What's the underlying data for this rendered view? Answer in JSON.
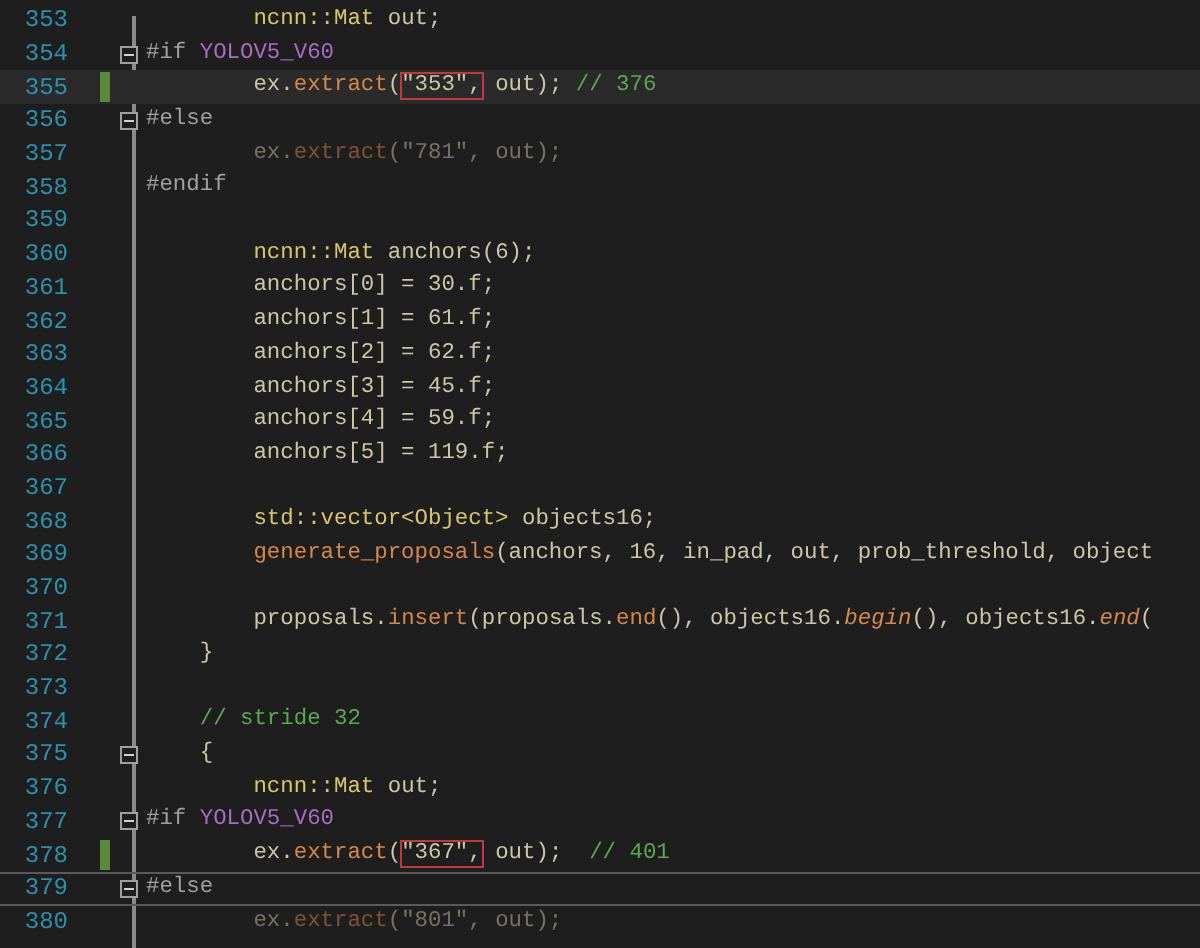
{
  "editor": {
    "lines": [
      {
        "number": "353",
        "current": false,
        "changed": false,
        "collapsible": false,
        "inactive": false,
        "framed": false,
        "tokens": [
          {
            "kind": "type",
            "text": "        ncnn::Mat"
          },
          {
            "kind": "plain",
            "text": " out;"
          }
        ]
      },
      {
        "number": "354",
        "current": false,
        "changed": false,
        "collapsible": true,
        "inactive": false,
        "framed": false,
        "tokens": [
          {
            "kind": "preproc",
            "text": "#if "
          },
          {
            "kind": "macro",
            "text": "YOLOV5_V60"
          }
        ]
      },
      {
        "number": "355",
        "current": true,
        "changed": true,
        "collapsible": false,
        "inactive": false,
        "framed": false,
        "tokens": [
          {
            "kind": "plain",
            "text": "        ex."
          },
          {
            "kind": "func",
            "text": "extract"
          },
          {
            "kind": "plain",
            "text": "("
          },
          {
            "kind": "boxed",
            "text": "\"353\","
          },
          {
            "kind": "plain",
            "text": " out); "
          },
          {
            "kind": "comment",
            "text": "// 376"
          }
        ]
      },
      {
        "number": "356",
        "current": false,
        "changed": false,
        "collapsible": true,
        "inactive": false,
        "framed": false,
        "tokens": [
          {
            "kind": "preproc",
            "text": "#else"
          }
        ]
      },
      {
        "number": "357",
        "current": false,
        "changed": false,
        "collapsible": false,
        "inactive": true,
        "framed": false,
        "tokens": [
          {
            "kind": "plain",
            "text": "        ex."
          },
          {
            "kind": "func",
            "text": "extract"
          },
          {
            "kind": "plain",
            "text": "(\"781\", out);"
          }
        ]
      },
      {
        "number": "358",
        "current": false,
        "changed": false,
        "collapsible": false,
        "inactive": false,
        "framed": false,
        "tokens": [
          {
            "kind": "preproc",
            "text": "#endif"
          }
        ]
      },
      {
        "number": "359",
        "current": false,
        "changed": false,
        "collapsible": false,
        "framed": false
      },
      {
        "number": "360",
        "current": false,
        "changed": false,
        "collapsible": false,
        "inactive": false,
        "framed": false,
        "tokens": [
          {
            "kind": "type",
            "text": "        ncnn::Mat"
          },
          {
            "kind": "plain",
            "text": " anchors(6);"
          }
        ]
      },
      {
        "number": "361",
        "current": false,
        "changed": false,
        "collapsible": false,
        "inactive": false,
        "framed": false,
        "tokens": [
          {
            "kind": "plain",
            "text": "        anchors[0] = 30.f;"
          }
        ]
      },
      {
        "number": "362",
        "current": false,
        "changed": false,
        "collapsible": false,
        "inactive": false,
        "framed": false,
        "tokens": [
          {
            "kind": "plain",
            "text": "        anchors[1] = 61.f;"
          }
        ]
      },
      {
        "number": "363",
        "current": false,
        "changed": false,
        "collapsible": false,
        "inactive": false,
        "framed": false,
        "tokens": [
          {
            "kind": "plain",
            "text": "        anchors[2] = 62.f;"
          }
        ]
      },
      {
        "number": "364",
        "current": false,
        "changed": false,
        "collapsible": false,
        "inactive": false,
        "framed": false,
        "tokens": [
          {
            "kind": "plain",
            "text": "        anchors[3] = 45.f;"
          }
        ]
      },
      {
        "number": "365",
        "current": false,
        "changed": false,
        "collapsible": false,
        "inactive": false,
        "framed": false,
        "tokens": [
          {
            "kind": "plain",
            "text": "        anchors[4] = 59.f;"
          }
        ]
      },
      {
        "number": "366",
        "current": false,
        "changed": false,
        "collapsible": false,
        "inactive": false,
        "framed": false,
        "tokens": [
          {
            "kind": "plain",
            "text": "        anchors[5] = 119.f;"
          }
        ]
      },
      {
        "number": "367",
        "current": false,
        "changed": false,
        "collapsible": false,
        "framed": false
      },
      {
        "number": "368",
        "current": false,
        "changed": false,
        "collapsible": false,
        "inactive": false,
        "framed": false,
        "tokens": [
          {
            "kind": "type",
            "text": "        std::vector<Object>"
          },
          {
            "kind": "plain",
            "text": " objects16;"
          }
        ]
      },
      {
        "number": "369",
        "current": false,
        "changed": false,
        "collapsible": false,
        "inactive": false,
        "framed": false,
        "tokens": [
          {
            "kind": "func",
            "text": "        generate_proposals"
          },
          {
            "kind": "plain",
            "text": "(anchors, 16, in_pad, out, prob_threshold, object"
          }
        ]
      },
      {
        "number": "370",
        "current": false,
        "changed": false,
        "collapsible": false,
        "framed": false
      },
      {
        "number": "371",
        "current": false,
        "changed": false,
        "collapsible": false,
        "inactive": false,
        "framed": false,
        "tokens": [
          {
            "kind": "plain",
            "text": "        proposals."
          },
          {
            "kind": "func",
            "text": "insert"
          },
          {
            "kind": "plain",
            "text": "(proposals."
          },
          {
            "kind": "func",
            "text": "end"
          },
          {
            "kind": "plain",
            "text": "(), objects16."
          },
          {
            "kind": "italic",
            "text": "begin"
          },
          {
            "kind": "plain",
            "text": "(), objects16."
          },
          {
            "kind": "italic",
            "text": "end"
          },
          {
            "kind": "plain",
            "text": "("
          }
        ]
      },
      {
        "number": "372",
        "current": false,
        "changed": false,
        "collapsible": false,
        "inactive": false,
        "framed": false,
        "tokens": [
          {
            "kind": "plain",
            "text": "    }"
          }
        ]
      },
      {
        "number": "373",
        "current": false,
        "changed": false,
        "collapsible": false,
        "framed": false
      },
      {
        "number": "374",
        "current": false,
        "changed": false,
        "collapsible": false,
        "inactive": false,
        "framed": false,
        "tokens": [
          {
            "kind": "comment",
            "text": "    // stride 32"
          }
        ]
      },
      {
        "number": "375",
        "current": false,
        "changed": false,
        "collapsible": true,
        "inactive": false,
        "framed": false,
        "tokens": [
          {
            "kind": "plain",
            "text": "    {"
          }
        ]
      },
      {
        "number": "376",
        "current": false,
        "changed": false,
        "collapsible": false,
        "inactive": false,
        "framed": false,
        "tokens": [
          {
            "kind": "type",
            "text": "        ncnn::Mat"
          },
          {
            "kind": "plain",
            "text": " out;"
          }
        ]
      },
      {
        "number": "377",
        "current": false,
        "changed": false,
        "collapsible": true,
        "inactive": false,
        "framed": false,
        "tokens": [
          {
            "kind": "preproc",
            "text": "#if "
          },
          {
            "kind": "macro",
            "text": "YOLOV5_V60"
          }
        ]
      },
      {
        "number": "378",
        "current": false,
        "changed": true,
        "collapsible": false,
        "inactive": false,
        "framed": false,
        "tokens": [
          {
            "kind": "plain",
            "text": "        ex."
          },
          {
            "kind": "func",
            "text": "extract"
          },
          {
            "kind": "plain",
            "text": "("
          },
          {
            "kind": "boxed",
            "text": "\"367\","
          },
          {
            "kind": "plain",
            "text": " out);  "
          },
          {
            "kind": "comment",
            "text": "// 401"
          }
        ]
      },
      {
        "number": "379",
        "current": false,
        "changed": false,
        "collapsible": true,
        "inactive": false,
        "framed": true,
        "tokens": [
          {
            "kind": "preproc",
            "text": "#else"
          }
        ]
      },
      {
        "number": "380",
        "current": false,
        "changed": false,
        "collapsible": false,
        "inactive": true,
        "framed": false,
        "tokens": [
          {
            "kind": "plain",
            "text": "        ex."
          },
          {
            "kind": "func",
            "text": "extract"
          },
          {
            "kind": "plain",
            "text": "(\"801\", out);"
          }
        ]
      }
    ]
  }
}
